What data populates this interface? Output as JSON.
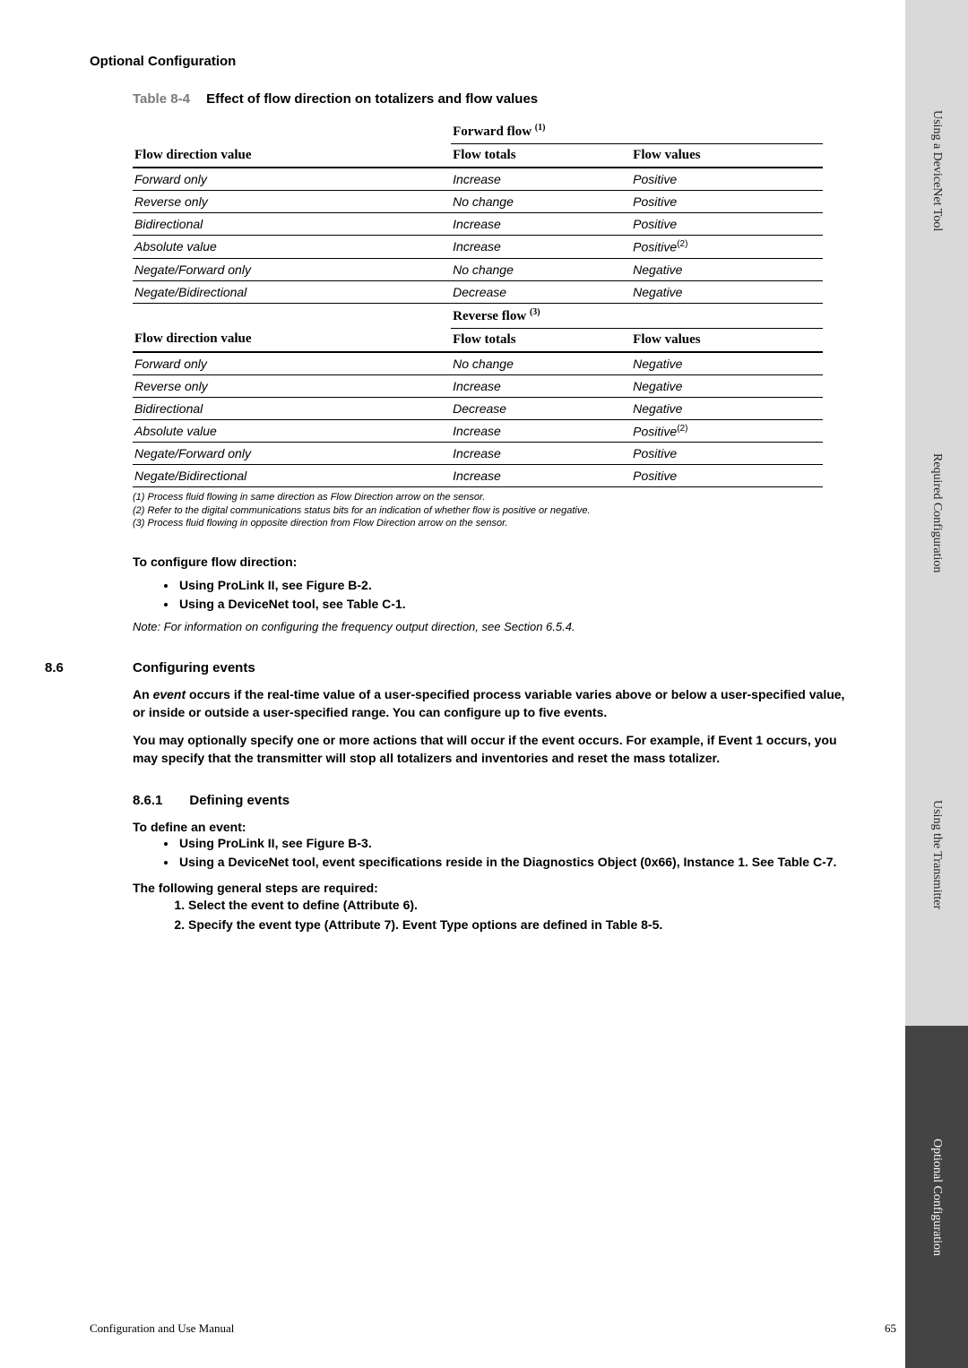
{
  "header": {
    "section": "Optional Configuration"
  },
  "table": {
    "caption_number": "Table 8-4",
    "caption_title": "Effect of flow direction on totalizers and flow values",
    "group1_header": "Forward flow",
    "group1_note": "(1)",
    "group2_header": "Reverse flow",
    "group2_note": "(3)",
    "col1": "Flow direction value",
    "col2": "Flow totals",
    "col3": "Flow values",
    "rows1": [
      {
        "dir": "Forward only",
        "tot": "Increase",
        "val": "Positive"
      },
      {
        "dir": "Reverse only",
        "tot": "No change",
        "val": "Positive"
      },
      {
        "dir": "Bidirectional",
        "tot": "Increase",
        "val": "Positive"
      },
      {
        "dir": "Absolute value",
        "tot": "Increase",
        "val": "Positive",
        "valnote": "(2)"
      },
      {
        "dir": "Negate/Forward only",
        "tot": "No change",
        "val": "Negative"
      },
      {
        "dir": "Negate/Bidirectional",
        "tot": "Decrease",
        "val": "Negative"
      }
    ],
    "rows2": [
      {
        "dir": "Forward only",
        "tot": "No change",
        "val": "Negative"
      },
      {
        "dir": "Reverse only",
        "tot": "Increase",
        "val": "Negative"
      },
      {
        "dir": "Bidirectional",
        "tot": "Decrease",
        "val": "Negative"
      },
      {
        "dir": "Absolute value",
        "tot": "Increase",
        "val": "Positive",
        "valnote": "(2)"
      },
      {
        "dir": "Negate/Forward only",
        "tot": "Increase",
        "val": "Positive"
      },
      {
        "dir": "Negate/Bidirectional",
        "tot": "Increase",
        "val": "Positive"
      }
    ],
    "footnotes": [
      "(1) Process fluid flowing in same direction as Flow Direction arrow on the sensor.",
      "(2) Refer to the digital communications status bits for an indication of whether flow is positive or negative.",
      "(3) Process fluid flowing in opposite direction from Flow Direction arrow on the sensor."
    ]
  },
  "instr1": {
    "lead": "To configure flow direction:",
    "b1": "Using ProLink II, see Figure B-2.",
    "b2": "Using a DeviceNet tool, see Table C-1.",
    "note": "Note: For information on configuring the frequency output direction, see Section 6.5.4."
  },
  "sec86": {
    "num": "8.6",
    "title": "Configuring events",
    "p1a": "An ",
    "p1b": "event",
    "p1c": " occurs if the real-time value of a user-specified process variable varies above or below a user-specified value, or inside or outside a user-specified range. You can configure up to five events.",
    "p2": "You may optionally specify one or more actions that will occur if the event occurs. For example, if Event 1 occurs, you may specify that the transmitter will stop all totalizers and inventories and reset the mass totalizer."
  },
  "sec861": {
    "num": "8.6.1",
    "title": "Defining events",
    "lead": "To define an event:",
    "b1": "Using ProLink II, see Figure B-3.",
    "b2": "Using a DeviceNet tool, event specifications reside in the Diagnostics Object (0x66), Instance 1. See Table C-7.",
    "steps_lead": "The following general steps are required:",
    "s1": "Select the event to define (Attribute 6).",
    "s2": "Specify the event type (Attribute 7). Event Type options are defined in Table 8-5."
  },
  "tabs": {
    "t1": "Using a DeviceNet Tool",
    "t2": "Required Configuration",
    "t3": "Using the Transmitter",
    "t4": "Optional Configuration"
  },
  "footer": {
    "left": "Configuration and Use Manual",
    "right": "65"
  }
}
